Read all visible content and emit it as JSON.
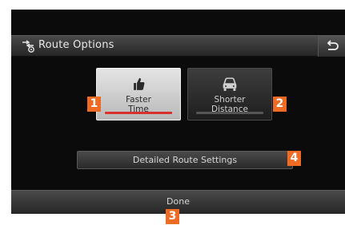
{
  "header": {
    "title": "Route Options",
    "title_icon": "route-options-icon",
    "back_icon": "back-arrow-icon"
  },
  "options": [
    {
      "label_line1": "Faster",
      "label_line2": "Time",
      "icon": "thumbs-up-icon",
      "selected": true
    },
    {
      "label_line1": "Shorter",
      "label_line2": "Distance",
      "icon": "car-icon",
      "selected": false
    }
  ],
  "detail_button": {
    "label": "Detailed Route Settings"
  },
  "done_button": {
    "label": "Done"
  },
  "callouts": {
    "c1": "1",
    "c2": "2",
    "c3": "3",
    "c4": "4"
  },
  "colors": {
    "accent_selected": "#d9302b",
    "callout": "#ef6a22",
    "screen_bg": "#0b0b0b"
  }
}
